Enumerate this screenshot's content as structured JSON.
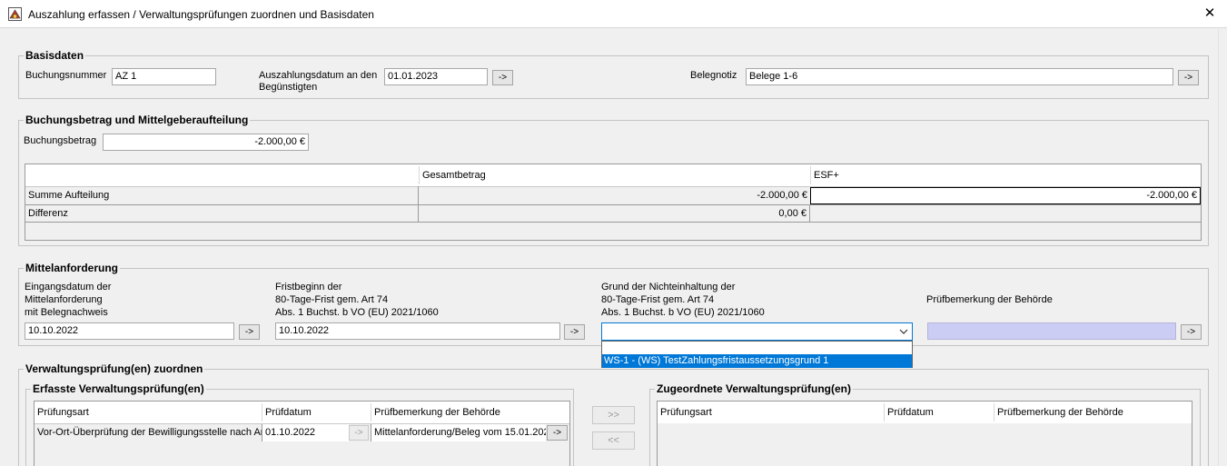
{
  "window": {
    "title": "Auszahlung erfassen / Verwaltungsprüfungen zuordnen und Basisdaten",
    "close": "✕"
  },
  "basisdaten": {
    "legend": "Basisdaten",
    "buchungsnummer_label": "Buchungsnummer",
    "buchungsnummer_value": "AZ 1",
    "auszahlungsdatum_label_1": "Auszahlungsdatum an den",
    "auszahlungsdatum_label_2": "Begünstigten",
    "auszahlungsdatum_value": "01.01.2023",
    "belegnotiz_label": "Belegnotiz",
    "belegnotiz_value": "Belege 1-6",
    "arrow": "->"
  },
  "buchungsbetrag": {
    "legend": "Buchungsbetrag und Mittelgeberaufteilung",
    "label": "Buchungsbetrag",
    "value": "-2.000,00 €",
    "table": {
      "headers": [
        "",
        "Gesamtbetrag",
        "ESF+"
      ],
      "rows": [
        {
          "label": "Summe Aufteilung",
          "gesamt": "-2.000,00 €",
          "esf": "-2.000,00 €"
        },
        {
          "label": "Differenz",
          "gesamt": "0,00 €",
          "esf": ""
        }
      ]
    }
  },
  "mittelanforderung": {
    "legend": "Mittelanforderung",
    "eingang_label": [
      "Eingangsdatum der",
      "Mittelanforderung",
      "mit Belegnachweis"
    ],
    "eingang_value": "10.10.2022",
    "frist_label": [
      "Fristbeginn der",
      "80-Tage-Frist gem. Art 74",
      "Abs. 1 Buchst. b VO (EU) 2021/1060"
    ],
    "frist_value": "10.10.2022",
    "grund_label": [
      "Grund der Nichteinhaltung der",
      "80-Tage-Frist gem. Art 74",
      "Abs. 1 Buchst. b VO (EU) 2021/1060"
    ],
    "grund_value": "",
    "grund_options": [
      "",
      "WS-1 - (WS) TestZahlungsfristaussetzungsgrund 1"
    ],
    "pruef_label": "Prüfbemerkung der Behörde",
    "pruef_value": "",
    "arrow": "->"
  },
  "verwaltung": {
    "legend": "Verwaltungsprüfung(en) zuordnen",
    "erfasste": {
      "legend": "Erfasste Verwaltungsprüfung(en)",
      "headers": [
        "Prüfungsart",
        "Prüfdatum",
        "Prüfbemerkung der Behörde"
      ],
      "rows": [
        {
          "art": "Vor-Ort-Überprüfung der Bewilligungsstelle nach Art",
          "datum": "01.10.2022",
          "bemerkung": "Mittelanforderung/Beleg vom 15.01.202"
        }
      ]
    },
    "move_right": ">>",
    "move_left": "<<",
    "zugeordnete": {
      "legend": "Zugeordnete Verwaltungsprüfung(en)",
      "headers": [
        "Prüfungsart",
        "Prüfdatum",
        "Prüfbemerkung der Behörde"
      ]
    },
    "arrow": "->"
  },
  "colors": {
    "selection": "#0078d7",
    "disabled_field": "#cccdf5",
    "dropdown_border": "#0078d7"
  }
}
